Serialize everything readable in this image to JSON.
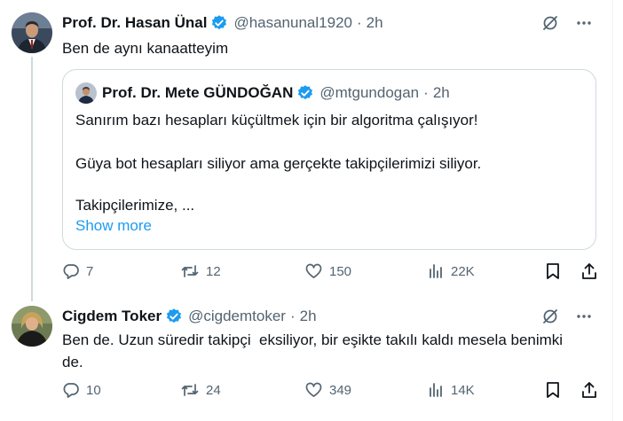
{
  "tweets": [
    {
      "author": {
        "name": "Prof. Dr. Hasan Ünal",
        "handle": "@hasanunal1920",
        "time": "2h"
      },
      "text": "Ben de aynı kanaatteyim",
      "quote": {
        "author": {
          "name": "Prof. Dr. Mete GÜNDOĞAN",
          "handle": "@mtgundogan",
          "time": "2h"
        },
        "lines": [
          "Sanırım bazı hesapları küçültmek için bir algoritma çalışıyor!",
          "Güya bot hesapları siliyor ama gerçekte takipçilerimizi siliyor.",
          "Takipçilerimize, ..."
        ],
        "show_more": "Show more"
      },
      "stats": {
        "replies": "7",
        "reposts": "12",
        "likes": "150",
        "views": "22K"
      }
    },
    {
      "author": {
        "name": "Cigdem Toker",
        "handle": "@cigdemtoker",
        "time": "2h"
      },
      "text_lines": [
        "Ben de. Uzun süredir takipçi  eksiliyor, bir eşikte takılı kaldı mesela benimki",
        "de."
      ],
      "stats": {
        "replies": "10",
        "reposts": "24",
        "likes": "349",
        "views": "14K"
      }
    }
  ],
  "separator": "·",
  "colors": {
    "verified": "#1d9bf0",
    "secondary_text": "#536471",
    "link": "#1d9bf0",
    "border": "#cfd9de"
  },
  "icons": [
    "verified-badge-icon",
    "grok-icon",
    "more-icon",
    "reply-icon",
    "repost-icon",
    "like-icon",
    "views-icon",
    "bookmark-icon",
    "share-icon"
  ]
}
